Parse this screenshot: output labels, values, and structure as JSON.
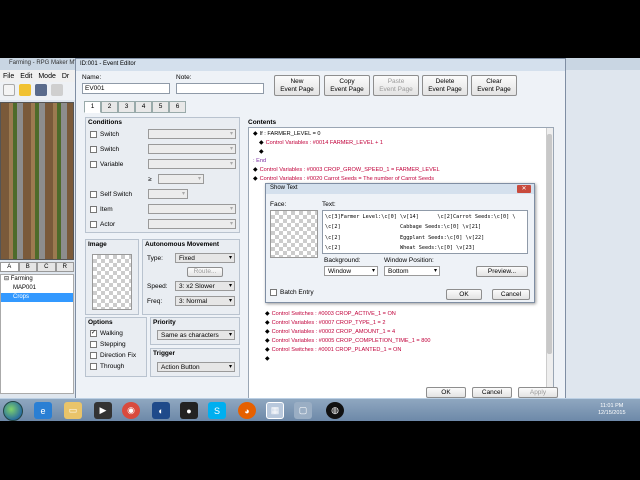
{
  "bg_app": {
    "title": "Farming - RPG Maker MV",
    "menu": [
      "File",
      "Edit",
      "Mode",
      "Dr"
    ],
    "tileset_tabs": [
      "A",
      "B",
      "C",
      "R"
    ],
    "tree": [
      {
        "label": "Farming"
      },
      {
        "label": "MAP001"
      },
      {
        "label": "Crops"
      }
    ]
  },
  "event_editor": {
    "title": "ID:001 - Event Editor",
    "name_label": "Name:",
    "name_value": "EV001",
    "note_label": "Note:",
    "note_value": "",
    "buttons": {
      "new_page": [
        "New",
        "Event Page"
      ],
      "copy_page": [
        "Copy",
        "Event Page"
      ],
      "paste_page": [
        "Paste",
        "Event Page"
      ],
      "delete_page": [
        "Delete",
        "Event Page"
      ],
      "clear_page": [
        "Clear",
        "Event Page"
      ]
    },
    "page_tabs": [
      "1",
      "2",
      "3",
      "4",
      "5",
      "6"
    ],
    "conditions": {
      "title": "Conditions",
      "switch1": "Switch",
      "switch2": "Switch",
      "variable": "Variable",
      "gte": "≥",
      "self_switch": "Self Switch",
      "item": "Item",
      "actor": "Actor"
    },
    "image": {
      "title": "Image"
    },
    "autonomous": {
      "title": "Autonomous Movement",
      "type_label": "Type:",
      "type_value": "Fixed",
      "route_button": "Route...",
      "speed_label": "Speed:",
      "speed_value": "3: x2 Slower",
      "freq_label": "Freq:",
      "freq_value": "3: Normal"
    },
    "options": {
      "title": "Options",
      "walking": "Walking",
      "stepping": "Stepping",
      "direction_fix": "Direction Fix",
      "through": "Through"
    },
    "priority": {
      "title": "Priority",
      "value": "Same as characters"
    },
    "trigger": {
      "title": "Trigger",
      "value": "Action Button"
    },
    "contents_title": "Contents",
    "contents_top": [
      "If : FARMER_LEVEL = 0",
      "Control Variables : #0014 FARMER_LEVEL + 1",
      "",
      ": End",
      "Control Variables : #0003 CROP_GROW_SPEED_1 = FARMER_LEVEL",
      "Control Variables : #0020 Carrot Seeds = The number of Carrot Seeds"
    ],
    "contents_bottom": [
      "Control Switches : #0003 CROP_ACTIVE_1 = ON",
      "Control Variables : #0007 CROP_TYPE_1 = 2",
      "Control Variables : #0002 CROP_AMOUNT_1 = 4",
      "Control Variables : #0005 CROP_COMPLETION_TIME_1 = 800",
      "Control Switches : #0001 CROP_PLANTED_1 = ON",
      ""
    ],
    "ok": "OK",
    "cancel": "Cancel",
    "apply": "Apply"
  },
  "show_text": {
    "title": "Show Text",
    "face_label": "Face:",
    "text_label": "Text:",
    "text_lines": [
      "\\c[3]Farmer Level:\\c[0] \\v[14]      \\c[2]Carrot Seeds:\\c[0] \\",
      "\\c[2]                   Cabbage Seeds:\\c[0] \\v[21]",
      "\\c[2]                   Eggplant Seeds:\\c[0] \\v[22]",
      "\\c[2]                   Wheat Seeds:\\c[0] \\v[23]"
    ],
    "background_label": "Background:",
    "background_value": "Window",
    "position_label": "Window Position:",
    "position_value": "Bottom",
    "preview": "Preview...",
    "batch_entry": "Batch Entry",
    "ok": "OK",
    "cancel": "Cancel"
  },
  "taskbar": {
    "time": "11:01 PM",
    "date": "12/15/2015"
  }
}
